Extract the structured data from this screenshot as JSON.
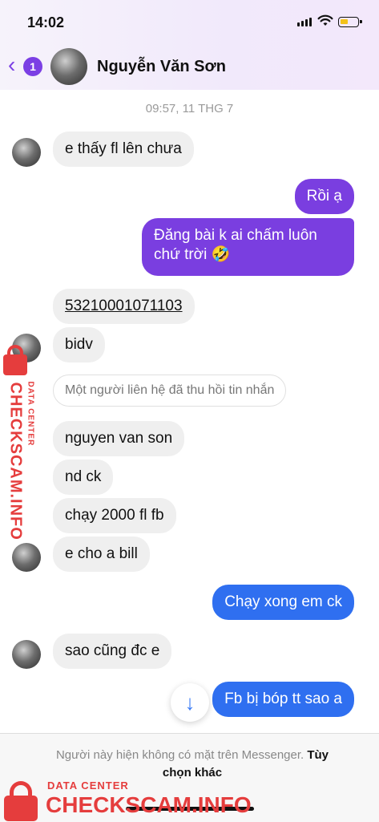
{
  "status_bar": {
    "time": "14:02"
  },
  "header": {
    "back_badge": "1",
    "contact_name": "Nguyễn Văn Sơn"
  },
  "conversation": {
    "timestamp": "09:57, 11 THG 7",
    "messages": [
      {
        "from": "them",
        "text": "e thấy fl lên chưa"
      },
      {
        "from": "me",
        "text": "Rồi ạ"
      },
      {
        "from": "me",
        "text_line1": "Đăng bài k ai chấm luôn",
        "text_line2": "chứ trời 🤣"
      },
      {
        "from": "them",
        "text": "53210001071103"
      },
      {
        "from": "them",
        "text": "bidv"
      },
      {
        "from": "system",
        "text": "Một người liên hệ đã thu hồi tin nhắn"
      },
      {
        "from": "them",
        "text": "nguyen van son"
      },
      {
        "from": "them",
        "text": "nd ck"
      },
      {
        "from": "them",
        "text": "chạy 2000 fl fb"
      },
      {
        "from": "them",
        "text": "e cho a bill"
      },
      {
        "from": "me",
        "text": "Chạy xong em ck"
      },
      {
        "from": "them",
        "text": "sao cũng đc e"
      },
      {
        "from": "me",
        "text": "Fb bị bóp tt sao a"
      }
    ]
  },
  "footer": {
    "notice": "Người này hiện không có mặt trên Messenger.",
    "option_line1": "Tùy",
    "option_line2": "chọn khác"
  },
  "watermark": {
    "side_main": "CHECKSCAM.INFO",
    "side_sub": "DATA CENTER",
    "bottom_sub": "DATA CENTER",
    "bottom_main": "CHECKSCAM.INFO"
  },
  "icons": {
    "back": "chevron-left-icon",
    "scroll": "arrow-down-icon",
    "signal": "signal-icon",
    "wifi": "wifi-icon",
    "battery": "battery-icon",
    "lock": "lock-icon"
  },
  "colors": {
    "incoming_bubble": "#efefef",
    "outgoing_purple": "#7a3ee0",
    "outgoing_blue": "#2f6ff0",
    "accent": "#7b3fe4",
    "watermark": "#e53d3d"
  }
}
